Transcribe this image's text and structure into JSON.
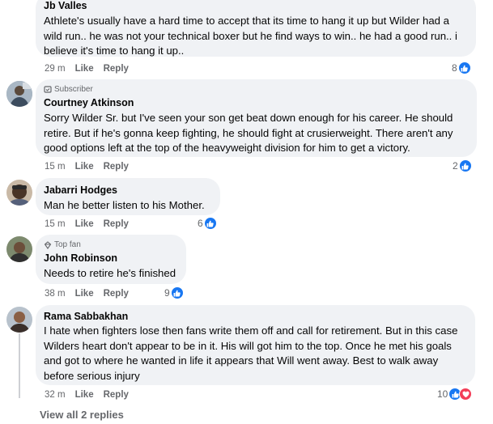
{
  "comments": [
    {
      "author": "Jb Valles",
      "badge": "",
      "text": "Athlete's usually have a hard time to accept that its time to hang it up but Wilder had a wild run.. he was not your technical boxer but he find ways to win.. he had a good run.. i believe it's time to hang it up..",
      "time": "29 m",
      "like_label": "Like",
      "reply_label": "Reply",
      "reactions": "8",
      "reaction_icons": [
        "like-icon"
      ]
    },
    {
      "author": "Courtney Atkinson",
      "badge": "Subscriber",
      "text": "Sorry Wilder Sr. but I've seen your son get beat down enough for his career. He should retire. But if he's gonna keep fighting, he should fight at crusierweight. There aren't any good options left at the top of the heavyweight division for him to get a victory.",
      "time": "15 m",
      "like_label": "Like",
      "reply_label": "Reply",
      "reactions": "2",
      "reaction_icons": [
        "like-icon"
      ]
    },
    {
      "author": "Jabarri Hodges",
      "badge": "",
      "text": "Man he better listen to his Mother.",
      "time": "15 m",
      "like_label": "Like",
      "reply_label": "Reply",
      "reactions": "6",
      "reaction_icons": [
        "like-icon"
      ]
    },
    {
      "author": "John Robinson",
      "badge": "Top fan",
      "text": "Needs to retire he's finished",
      "time": "38 m",
      "like_label": "Like",
      "reply_label": "Reply",
      "reactions": "9",
      "reaction_icons": [
        "like-icon"
      ]
    },
    {
      "author": "Rama Sabbakhan",
      "badge": "",
      "text": "I hate when fighters lose then fans write them off and call for retirement. But in this case Wilders heart don't appear to be in it. His will got him to the top. Once he met his goals and got to where he wanted in life it appears that Will went away. Best to walk away before serious injury",
      "time": "32 m",
      "like_label": "Like",
      "reply_label": "Reply",
      "reactions": "10",
      "reaction_icons": [
        "like-icon",
        "heart-icon"
      ]
    }
  ],
  "view_replies": "View all 2 replies",
  "colors": {
    "bubble": "#f0f2f5",
    "like": "#1877f2",
    "heart": "#f33e58",
    "meta": "#65676b"
  }
}
